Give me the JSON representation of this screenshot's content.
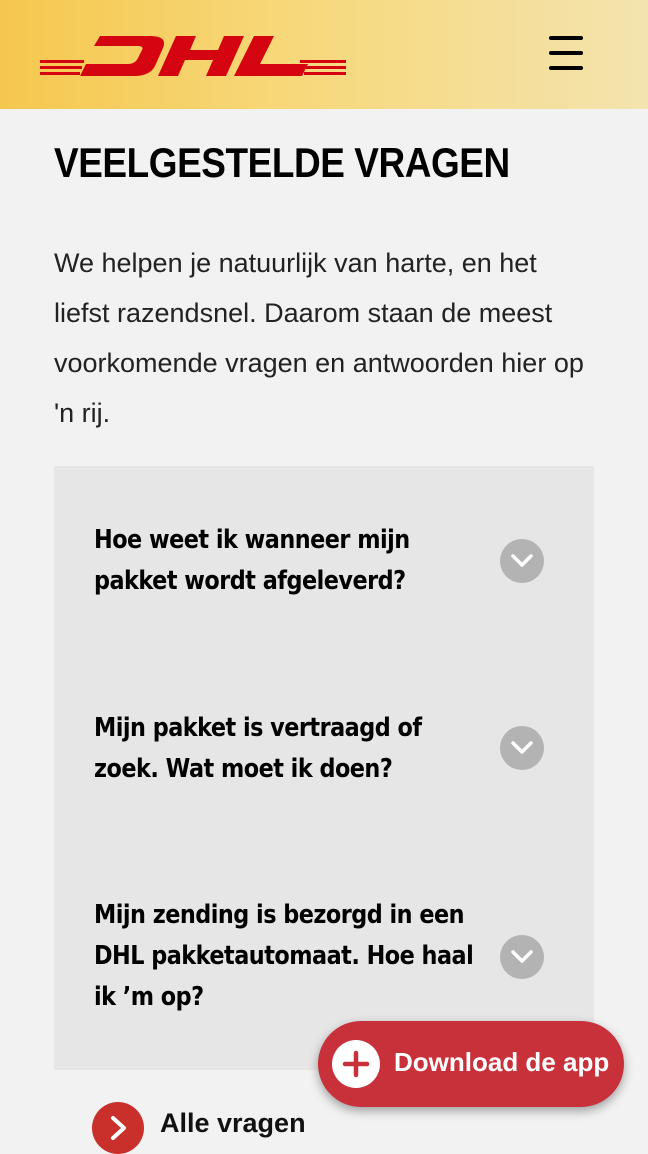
{
  "header": {
    "logo_text": "DHL",
    "menu_icon": "hamburger-menu-icon",
    "brand_color": "#d40511",
    "bar_color": "#f5c74e"
  },
  "page": {
    "title": "VEELGESTELDE VRAGEN",
    "intro": "We helpen je natuurlijk van harte, en het liefst razendsnel. Daarom staan de meest voorkomende vragen en antwoorden hier op 'n rij."
  },
  "faq": {
    "items": [
      {
        "question": "Hoe weet ik wanneer mijn pakket wordt afgeleverd?",
        "icon": "chevron-down-icon"
      },
      {
        "question": "Mijn pakket is vertraagd of zoek. Wat moet ik doen?",
        "icon": "chevron-down-icon"
      },
      {
        "question": "Mijn zending is bezorgd in een DHL pakketautomaat. Hoe haal ik ’m op?",
        "icon": "chevron-down-icon"
      }
    ]
  },
  "all_questions": {
    "label": "Alle vragen",
    "icon": "chevron-right-icon"
  },
  "download": {
    "label": "Download de app",
    "icon": "plus-icon",
    "color": "#c8313a"
  }
}
